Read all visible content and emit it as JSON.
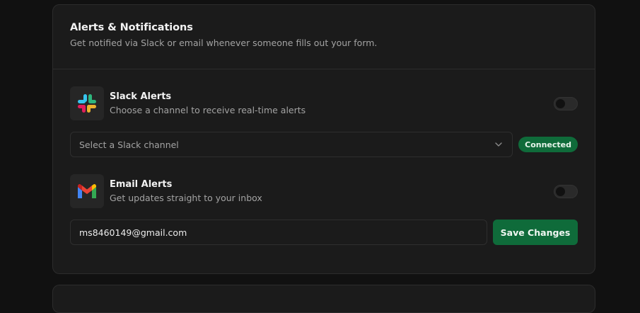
{
  "section": {
    "title": "Alerts & Notifications",
    "subtitle": "Get notified via Slack or email whenever someone fills out your form."
  },
  "slack": {
    "icon": "slack-logo",
    "title": "Slack Alerts",
    "description": "Choose a channel to receive real-time alerts",
    "enabled": false,
    "channel_select": {
      "value": "Select a Slack channel",
      "icon": "chevron-down-icon"
    },
    "status_badge": "Connected",
    "colors": {
      "badge": "#0f6b3a"
    }
  },
  "email": {
    "icon": "gmail-logo",
    "title": "Email Alerts",
    "description": "Get updates straight to your inbox",
    "enabled": false,
    "address": "ms8460149@gmail.com",
    "save_label": "Save Changes"
  },
  "colors": {
    "background": "#111111",
    "card": "#1b1b1b",
    "accent": "#0f6b3a"
  }
}
